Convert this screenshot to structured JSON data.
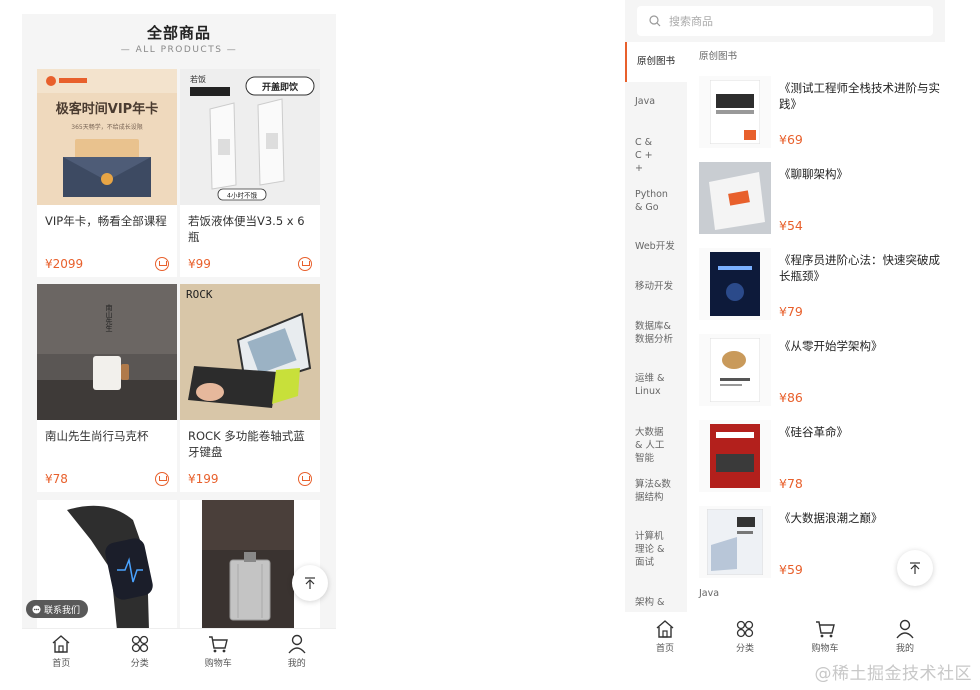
{
  "left": {
    "title": "全部商品",
    "subtitle": "— ALL PRODUCTS —",
    "products": [
      {
        "name": "VIP年卡，畅看全部课程",
        "price": "¥2099",
        "thumb_text": "极客时间VIP年卡",
        "thumb_sub": "365天畅学，不给成长设限"
      },
      {
        "name": "若饭液体便当V3.5 x 6瓶",
        "price": "¥99",
        "thumb_text": "开盖即饮",
        "thumb_sub": "4小时不饿"
      },
      {
        "name": "南山先生尚行马克杯",
        "price": "¥78",
        "thumb_text": "南山先生"
      },
      {
        "name": "ROCK 多功能卷轴式蓝牙键盘",
        "price": "¥199",
        "thumb_text": "ROCK"
      },
      {
        "name": "",
        "price": ""
      },
      {
        "name": "",
        "price": ""
      }
    ],
    "contact_label": "联系我们",
    "tabs": [
      "首页",
      "分类",
      "购物车",
      "我的"
    ]
  },
  "right": {
    "search_placeholder": "搜索商品",
    "categories": [
      "原创图书",
      "Java",
      "C & C + +",
      "Python & Go",
      "Web开发",
      "移动开发",
      "数据库&数据分析",
      "运维 & Linux",
      "大数据 & 人工智能",
      "算法&数据结构",
      "计算机理论 & 面试",
      "架构 &"
    ],
    "section_title": "原创图书",
    "next_section_title": "Java",
    "books": [
      {
        "title": "《测试工程师全栈技术进阶与实践》",
        "price": "¥69"
      },
      {
        "title": "《聊聊架构》",
        "price": "¥54"
      },
      {
        "title": "《程序员进阶心法：快速突破成长瓶颈》",
        "price": "¥79"
      },
      {
        "title": "《从零开始学架构》",
        "price": "¥86"
      },
      {
        "title": "《硅谷革命》",
        "price": "¥78"
      },
      {
        "title": "《大数据浪潮之巅》",
        "price": "¥59"
      }
    ],
    "tabs": [
      "首页",
      "分类",
      "购物车",
      "我的"
    ]
  },
  "watermark": "@稀土掘金技术社区",
  "colors": {
    "accent": "#e8602c",
    "bg": "#f5f5f5"
  }
}
